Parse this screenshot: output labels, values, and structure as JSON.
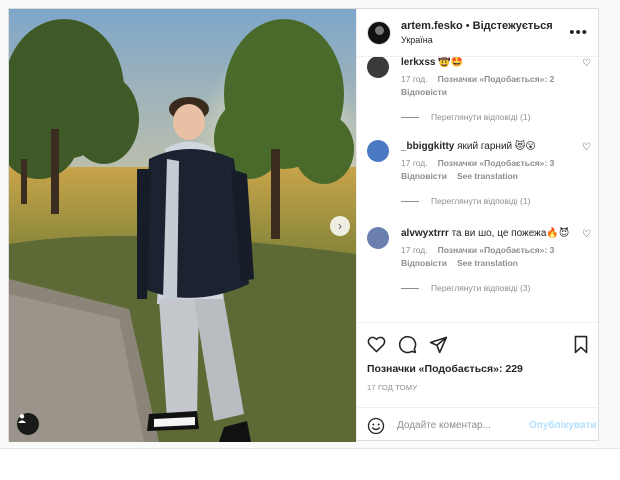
{
  "post": {
    "username": "artem.fesko",
    "separator": "•",
    "follow_label": "Відстежується",
    "location": "Україна",
    "more_icon": "more-horizontal-icon"
  },
  "comments": [
    {
      "user": "lerkxss",
      "text": "🤠🤩",
      "time": "17 год.",
      "likes_label": "Позначки «Подобається»: 2",
      "reply_label": "Відповісти",
      "translation_label": "",
      "view_replies": "Переглянути відповіді (1)",
      "avatar_color": "#3a3a3a"
    },
    {
      "user": "_bbiggkitty",
      "text": "який гарний 😻😮",
      "time": "17 год.",
      "likes_label": "Позначки «Подобається»: 3",
      "reply_label": "Відповісти",
      "translation_label": "See translation",
      "view_replies": "Переглянути відповіді (1)",
      "avatar_color": "#4a78c2"
    },
    {
      "user": "alvwyxtrrr",
      "text": "та ви шо, це пожежа🔥😈",
      "time": "17 год.",
      "likes_label": "Позначки «Подобається»: 3",
      "reply_label": "Відповісти",
      "translation_label": "See translation",
      "view_replies": "Переглянути відповіді (3)",
      "avatar_color": "#6a7fb0"
    }
  ],
  "actions": {
    "like_icon": "heart-icon",
    "comment_icon": "comment-icon",
    "share_icon": "send-icon",
    "save_icon": "bookmark-icon",
    "likes_text": "Позначки «Подобається»: 229",
    "time_ago": "17 ГОД ТОМУ"
  },
  "add_comment": {
    "placeholder": "Додайте коментар...",
    "publish_label": "Опублікувати",
    "emoji_icon": "emoji-icon"
  },
  "colors": {
    "accent_disabled": "#b2dffc",
    "text_primary": "#262626",
    "text_secondary": "#8e8e8e",
    "border": "#dbdbdb"
  }
}
